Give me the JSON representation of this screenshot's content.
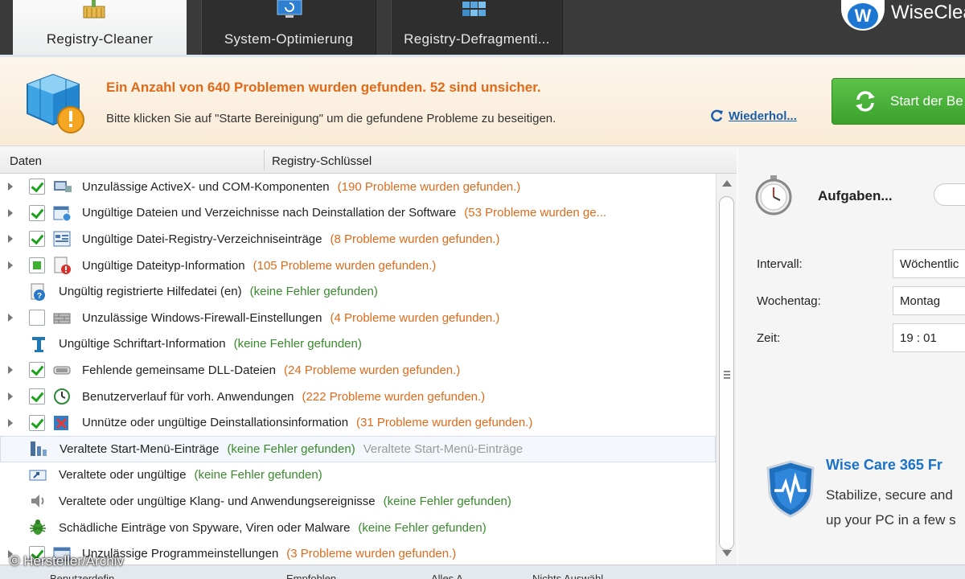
{
  "tabs": [
    {
      "label": "Registry-Cleaner",
      "active": true
    },
    {
      "label": "System-Optimierung",
      "active": false
    },
    {
      "label": "Registry-Defragmenti...",
      "active": false
    }
  ],
  "brand": {
    "logo_letter": "W",
    "name": "WiseClea"
  },
  "banner": {
    "title": "Ein Anzahl von 640 Problemen wurden gefunden. 52 sind unsicher.",
    "subtitle": "Bitte klicken Sie auf \"Starte Bereinigung\" um die gefundene Probleme zu beseitigen.",
    "repeat_label": "Wiederhol...",
    "start_label": "Start der Be"
  },
  "columns": {
    "data": "Daten",
    "key": "Registry-Schlüssel"
  },
  "rows": [
    {
      "label": "Unzulässige ActiveX- und COM-Komponenten",
      "status": "(190 Probleme wurden gefunden.)",
      "key": "",
      "expandable": true,
      "check": "checked",
      "icon": "activex-icon",
      "ok": false
    },
    {
      "label": "Ungültige Dateien und Verzeichnisse nach Deinstallation der Software",
      "status": "(53 Probleme wurden ge...",
      "key": "",
      "expandable": true,
      "check": "checked",
      "icon": "uninstall-folder-icon",
      "ok": false
    },
    {
      "label": "Ungültige Datei-Registry-Verzeichniseinträge",
      "status": "(8 Probleme wurden gefunden.)",
      "key": "",
      "expandable": true,
      "check": "checked",
      "icon": "registry-entry-icon",
      "ok": false
    },
    {
      "label": "Ungültige Dateityp-Information",
      "status": "(105 Probleme wurden gefunden.)",
      "key": "",
      "expandable": true,
      "check": "partial",
      "icon": "filetype-error-icon",
      "ok": false
    },
    {
      "label": "Ungültig registrierte Hilfedatei (en)",
      "status": "(keine Fehler gefunden)",
      "key": "",
      "expandable": false,
      "check": "none",
      "icon": "help-file-icon",
      "ok": true
    },
    {
      "label": "Unzulässige Windows-Firewall-Einstellungen",
      "status": "(4 Probleme wurden gefunden.)",
      "key": "",
      "expandable": true,
      "check": "unchecked",
      "icon": "firewall-icon",
      "ok": false
    },
    {
      "label": "Ungültige Schriftart-Information",
      "status": "(keine Fehler gefunden)",
      "key": "",
      "expandable": false,
      "check": "none",
      "icon": "font-icon",
      "ok": true
    },
    {
      "label": "Fehlende gemeinsame DLL-Dateien",
      "status": "(24 Probleme wurden gefunden.)",
      "key": "",
      "expandable": true,
      "check": "checked",
      "icon": "dll-icon",
      "ok": false
    },
    {
      "label": "Benutzerverlauf für vorh. Anwendungen",
      "status": "(222 Probleme wurden gefunden.)",
      "key": "",
      "expandable": true,
      "check": "checked",
      "icon": "history-icon",
      "ok": false
    },
    {
      "label": "Unnütze oder ungültige Deinstallationsinformation",
      "status": "(31 Probleme wurden gefunden.)",
      "key": "",
      "expandable": true,
      "check": "checked",
      "icon": "uninstall-info-icon",
      "ok": false
    },
    {
      "label": "Veraltete Start-Menü-Einträge",
      "status": "(keine Fehler gefunden)",
      "key": "Veraltete Start-Menü-Einträge",
      "expandable": false,
      "check": "none",
      "icon": "start-menu-icon",
      "ok": true,
      "highlight": true
    },
    {
      "label": "Veraltete oder ungültige",
      "status": "(keine Fehler gefunden)",
      "key": "",
      "expandable": false,
      "check": "none",
      "icon": "shortcut-icon",
      "ok": true
    },
    {
      "label": "Veraltete oder ungültige Klang- und Anwendungsereignisse",
      "status": "(keine Fehler gefunden)",
      "key": "",
      "expandable": false,
      "check": "none",
      "icon": "sound-icon",
      "ok": true
    },
    {
      "label": "Schädliche Einträge von Spyware, Viren oder Malware",
      "status": "(keine Fehler gefunden)",
      "key": "",
      "expandable": false,
      "check": "none",
      "icon": "malware-bug-icon",
      "ok": true
    },
    {
      "label": "Unzulässige Programmeinstellungen",
      "status": "(3 Probleme wurden gefunden.)",
      "key": "",
      "expandable": true,
      "check": "checked",
      "icon": "program-settings-icon",
      "ok": false
    }
  ],
  "schedule": {
    "title": "Aufgaben...",
    "interval_label": "Intervall:",
    "interval_value": "Wöchentlic",
    "weekday_label": "Wochentag:",
    "weekday_value": "Montag",
    "time_label": "Zeit:",
    "time_value": "19 : 01"
  },
  "promo": {
    "title": "Wise Care 365 Fr",
    "line1": "Stabilize, secure and",
    "line2": "up your PC in a few s"
  },
  "bottom": {
    "item1": "Benutzerdefin...",
    "item2": "Empfohlen",
    "item3": "Alles A...",
    "item4": "Nichts Auswähl..."
  },
  "watermark": "© Hersteller/Archiv",
  "colors": {
    "accent_orange": "#e06a1a",
    "ok_green": "#3a8a2e",
    "link_blue": "#1a5fae",
    "start_green": "#3aa22c",
    "promo_blue": "#1a72c8"
  }
}
